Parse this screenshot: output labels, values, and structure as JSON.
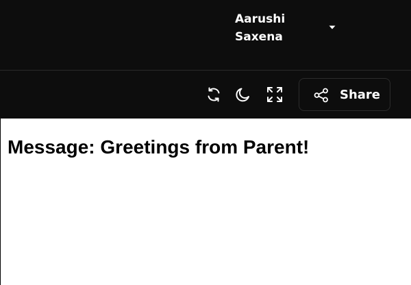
{
  "header": {
    "user": {
      "name": "Aarushi Saxena",
      "menu_icon": "chevron-down-icon"
    }
  },
  "toolbar": {
    "icons": [
      "refresh-icon",
      "moon-icon",
      "fullscreen-icon"
    ],
    "share": {
      "label": "Share",
      "icon": "share-icon"
    }
  },
  "content": {
    "message": "Message: Greetings from Parent!"
  },
  "colors": {
    "header_bg": "#0d0d0d",
    "text_light": "#ffffff",
    "content_bg": "#ffffff",
    "content_text": "#000000"
  }
}
